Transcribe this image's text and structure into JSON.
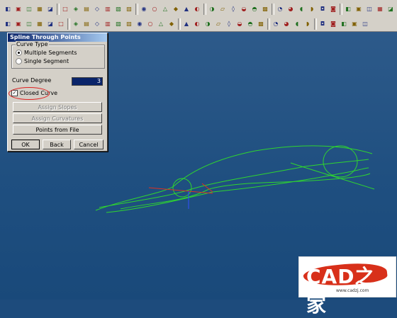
{
  "toolbar": {
    "row1_icons": [
      "select-icon",
      "redo-icon",
      "paste-icon",
      "undo-icon",
      "print-icon",
      "box-icon",
      "zoom-icon",
      "layer-icon",
      "fit-icon",
      "pan-icon",
      "grid-icon",
      "cube-icon",
      "cylinder-icon",
      "sphere-icon",
      "cone-icon",
      "shade-icon",
      "wire-icon",
      "light-icon",
      "view-icon",
      "front-icon",
      "top-icon",
      "iso-icon",
      "render-icon",
      "color-icon",
      "sheet-icon",
      "swatch-icon",
      "palette-icon",
      "axis-icon",
      "note-icon",
      "measure-icon",
      "list-icon",
      "plot-icon",
      "grid2-icon",
      "tile-icon",
      "split-icon",
      "help-icon"
    ],
    "row2_icons": [
      "point-icon",
      "line-icon",
      "spline-icon",
      "curve-icon",
      "plus-icon",
      "rect-icon",
      "circle-icon",
      "arc-icon",
      "offset-icon",
      "trim-icon",
      "fillet-icon",
      "chamfer-icon",
      "extend-icon",
      "project-icon",
      "bridge-icon",
      "mirror-icon",
      "curve-mod-icon",
      "angle-icon",
      "join-icon",
      "divide-icon",
      "blend-icon",
      "sweep-icon",
      "loft-icon",
      "revolve-icon",
      "extrude-icon",
      "surface-icon",
      "sew-icon",
      "bounded-icon",
      "face-icon",
      "shell-icon",
      "offset-surf-icon",
      "trim-surf-icon",
      "fill-icon"
    ]
  },
  "dialog": {
    "title": "Spline Through Points",
    "curve_type_label": "Curve Type",
    "options": {
      "multiple": "Multiple Segments",
      "single": "Single Segment"
    },
    "selected_option": "multiple",
    "curve_degree_label": "Curve Degree",
    "curve_degree_value": "3",
    "closed_curve_label": "Closed Curve",
    "closed_curve_checked": true,
    "buttons": {
      "assign_slopes": "Assign Slopes",
      "assign_curvatures": "Assign Curvatures",
      "points_from_file": "Points from File",
      "ok": "OK",
      "back": "Back",
      "cancel": "Cancel"
    }
  },
  "watermark": {
    "logo_text": "CAD之家",
    "url": "www.cadzj.com"
  },
  "colors": {
    "curve": "#2fd52f",
    "axis_red": "#e03020",
    "axis_blue": "#3050ff",
    "highlight_circle": "#e02020"
  }
}
